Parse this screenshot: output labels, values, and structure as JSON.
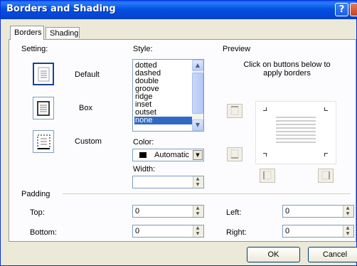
{
  "window": {
    "title": "Borders and Shading",
    "help_glyph": "?",
    "close_glyph": "×"
  },
  "tabs": [
    {
      "label": "Borders",
      "active": true
    },
    {
      "label": "Shading",
      "active": false
    }
  ],
  "setting": {
    "label": "Setting:",
    "options": [
      {
        "label": "Default",
        "icon": "page-lines-icon",
        "selected": true
      },
      {
        "label": "Box",
        "icon": "box-border-icon",
        "selected": false
      },
      {
        "label": "Custom",
        "icon": "custom-border-icon",
        "selected": false
      }
    ]
  },
  "style": {
    "label": "Style:",
    "items": [
      "dotted",
      "dashed",
      "double",
      "groove",
      "ridge",
      "inset",
      "outset",
      "none"
    ],
    "selected": "none"
  },
  "color": {
    "label": "Color:",
    "value": "Automatic",
    "swatch": "#000000"
  },
  "width": {
    "label": "Width:",
    "value": ""
  },
  "preview": {
    "label": "Preview",
    "instruction": "Click on buttons below to apply borders"
  },
  "padding": {
    "label": "Padding",
    "top": {
      "label": "Top:",
      "value": "0"
    },
    "bottom": {
      "label": "Bottom:",
      "value": "0"
    },
    "left": {
      "label": "Left:",
      "value": "0"
    },
    "right": {
      "label": "Right:",
      "value": "0"
    }
  },
  "buttons": {
    "ok": "OK",
    "cancel": "Cancel"
  },
  "colors": {
    "titlebar": "#0a5ff5",
    "selection": "#316ac5",
    "dialog": "#ece9d8"
  }
}
